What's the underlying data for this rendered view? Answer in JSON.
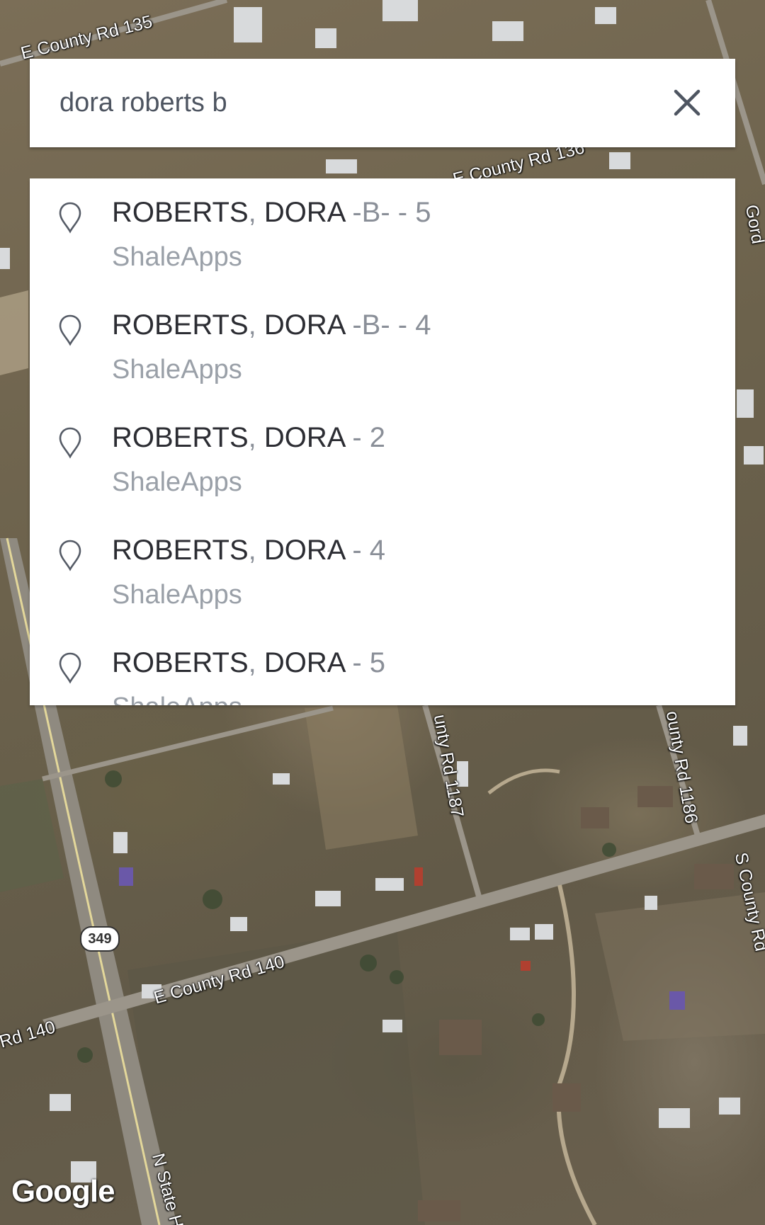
{
  "search": {
    "query": "dora roberts b",
    "clear_icon": "close-icon"
  },
  "results": [
    {
      "name": "ROBERTS",
      "sep": ",",
      "name2": " DORA",
      "suffix": " -B- - 5",
      "source": "ShaleApps",
      "icon": "map-pin-icon"
    },
    {
      "name": "ROBERTS",
      "sep": ",",
      "name2": " DORA",
      "suffix": " -B- - 4",
      "source": "ShaleApps",
      "icon": "map-pin-icon"
    },
    {
      "name": "ROBERTS",
      "sep": ",",
      "name2": " DORA",
      "suffix": " - 2",
      "source": "ShaleApps",
      "icon": "map-pin-icon"
    },
    {
      "name": "ROBERTS",
      "sep": ",",
      "name2": " DORA",
      "suffix": " - 4",
      "source": "ShaleApps",
      "icon": "map-pin-icon"
    },
    {
      "name": "ROBERTS",
      "sep": ",",
      "name2": " DORA",
      "suffix": " - 5",
      "source": "ShaleApps",
      "icon": "map-pin-icon"
    }
  ],
  "map": {
    "labels": {
      "county_rd_135": "E County Rd 135",
      "county_rd_136": "E County Rd 136",
      "county_rd_1187": "unty Rd 1187",
      "county_rd_1186": "ounty Rd 1186",
      "county_rd_140": "E County Rd 140",
      "rd_140_left": "Rd 140",
      "s_county_rd": "S County Rd",
      "n_state_hwy": "N State H",
      "gordon": "Gord"
    },
    "shield": "349",
    "attribution": "Google"
  }
}
